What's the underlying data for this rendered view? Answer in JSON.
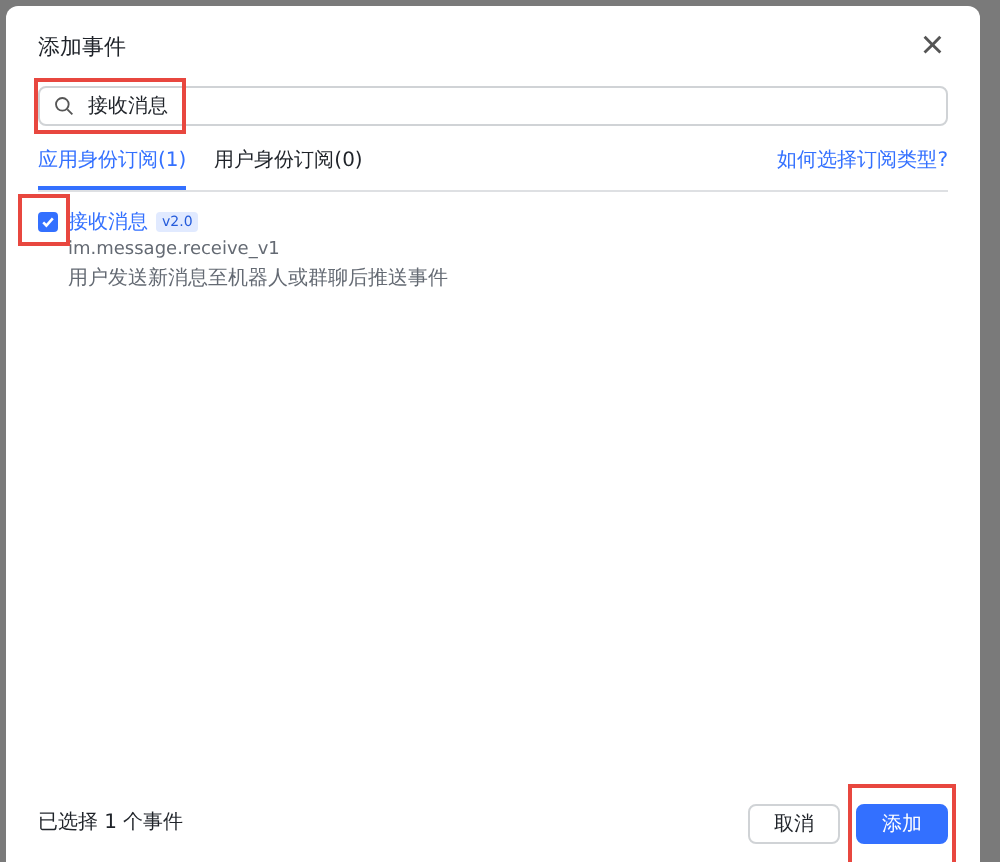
{
  "dialog": {
    "title": "添加事件",
    "close": "×"
  },
  "search": {
    "value": "接收消息",
    "highlighted": true
  },
  "tabs": [
    {
      "label": "应用身份订阅(1)",
      "selected": true
    },
    {
      "label": "用户身份订阅(0)",
      "selected": false
    }
  ],
  "help_link": "如何选择订阅类型?",
  "events": [
    {
      "name": "接收消息",
      "version": "v2.0",
      "api": "im.message.receive_v1",
      "description": "用户发送新消息至机器人或群聊后推送事件",
      "checked": true,
      "highlighted": true
    }
  ],
  "footer": {
    "summary": "已选择 1 个事件",
    "buttons": [
      {
        "label": "取消",
        "kind": "secondary",
        "highlighted": false
      },
      {
        "label": "添加",
        "kind": "primary",
        "highlighted": true
      }
    ]
  }
}
